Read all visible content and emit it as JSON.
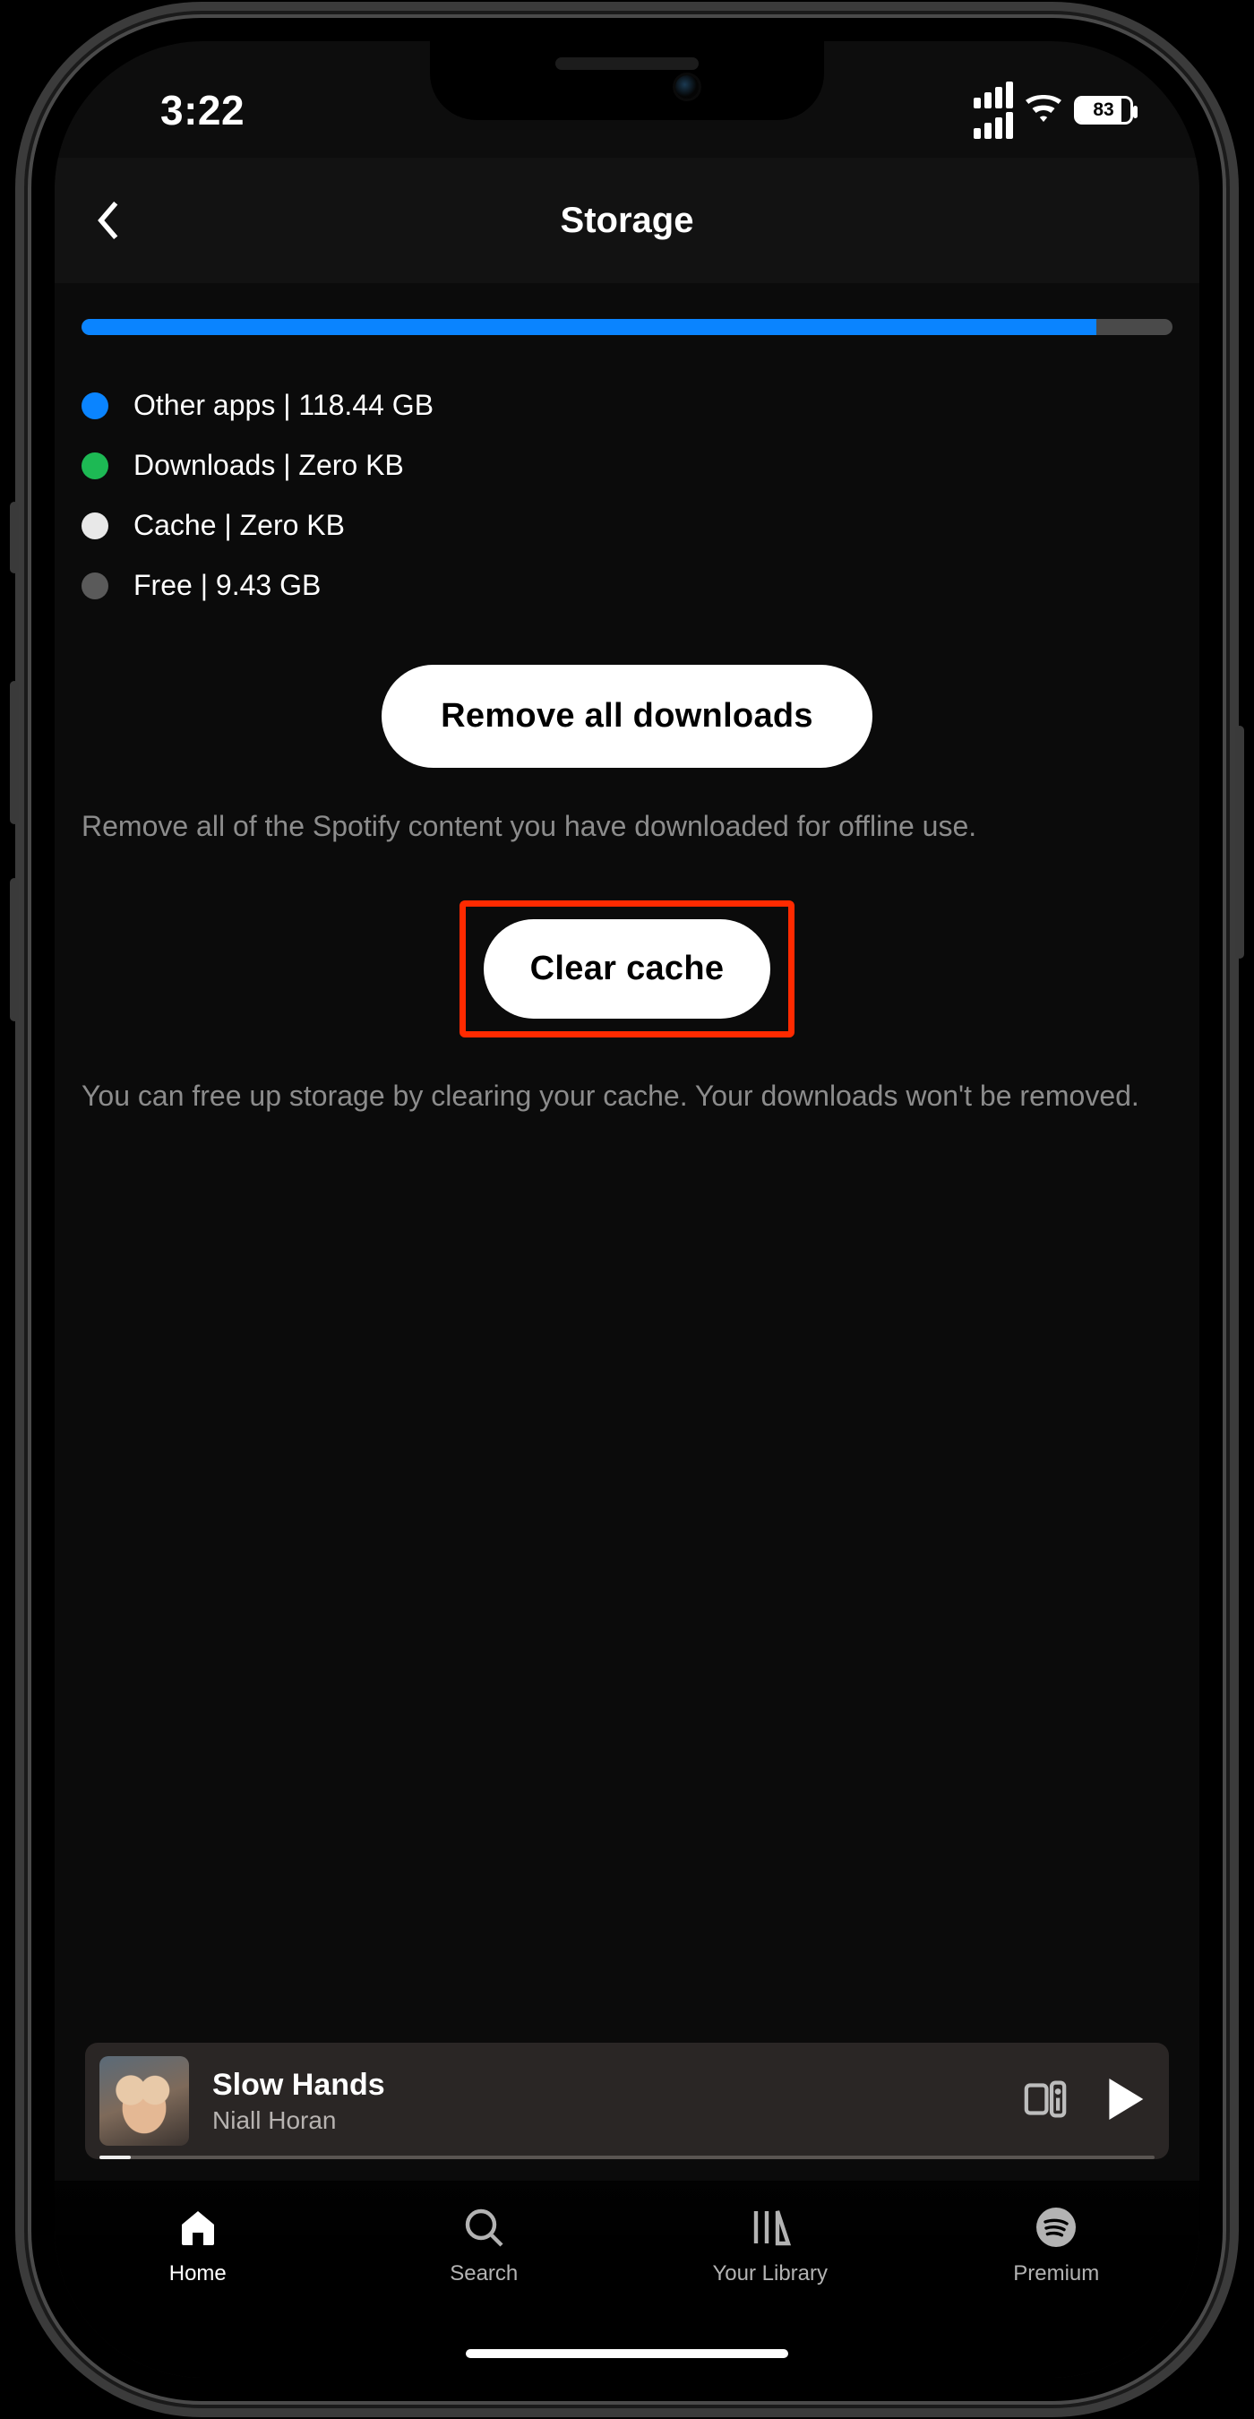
{
  "status": {
    "time": "3:22",
    "battery_pct": "83"
  },
  "header": {
    "title": "Storage"
  },
  "storage": {
    "fill_pct": 93,
    "legend": [
      {
        "label": "Other apps | 118.44 GB",
        "color": "#0a84ff"
      },
      {
        "label": "Downloads | Zero KB",
        "color": "#1db954"
      },
      {
        "label": "Cache | Zero KB",
        "color": "#e8e8e8"
      },
      {
        "label": "Free | 9.43 GB",
        "color": "#5a5a5a"
      }
    ],
    "remove_btn": "Remove all downloads",
    "remove_desc": "Remove all of the Spotify content you have downloaded for offline use.",
    "clear_btn": "Clear cache",
    "clear_desc": "You can free up storage by clearing your cache. Your downloads won't be removed."
  },
  "now_playing": {
    "title": "Slow Hands",
    "artist": "Niall Horan"
  },
  "nav": {
    "items": [
      {
        "label": "Home"
      },
      {
        "label": "Search"
      },
      {
        "label": "Your Library"
      },
      {
        "label": "Premium"
      }
    ]
  }
}
